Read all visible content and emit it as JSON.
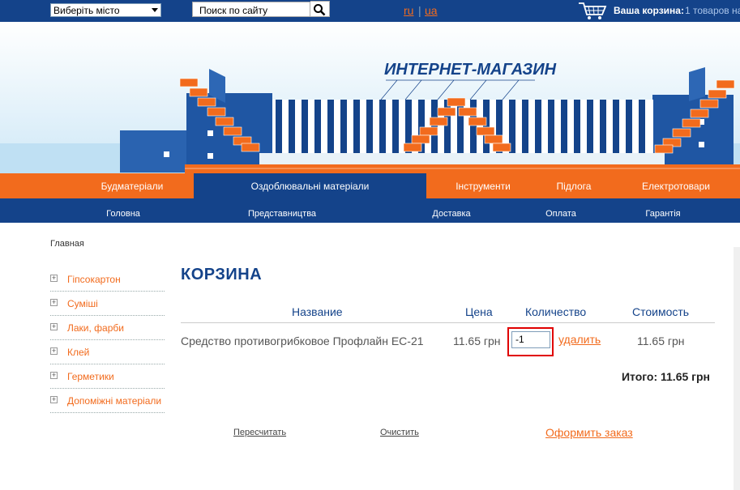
{
  "topbar": {
    "city_select": "Виберіть місто",
    "search_placeholder": "Поиск по сайту",
    "lang_ru": "ru",
    "lang_sep": "|",
    "lang_ua": "ua",
    "cart_label": "Ваша корзина:",
    "cart_count": "1 товаров на"
  },
  "banner": {
    "title": "ИНТЕРНЕТ-МАГАЗИН"
  },
  "nav_main": [
    {
      "label": "Будматеріали"
    },
    {
      "label": "Оздоблювальні матеріали"
    },
    {
      "label": "Інструменти"
    },
    {
      "label": "Підлога"
    },
    {
      "label": "Електротовари"
    }
  ],
  "nav_sub": [
    {
      "label": "Головна"
    },
    {
      "label": "Представництва"
    },
    {
      "label": "Доставка"
    },
    {
      "label": "Оплата"
    },
    {
      "label": "Гарантія"
    }
  ],
  "breadcrumb": "Главная",
  "sidebar": [
    {
      "label": "Гіпсокартон"
    },
    {
      "label": "Суміші"
    },
    {
      "label": "Лаки, фарби"
    },
    {
      "label": "Клей"
    },
    {
      "label": "Герметики"
    },
    {
      "label": "Допоміжні матеріали"
    }
  ],
  "main": {
    "title": "КОРЗИНА",
    "headers": {
      "name": "Название",
      "price": "Цена",
      "qty": "Количество",
      "cost": "Стоимость"
    },
    "row": {
      "name": "Средство противогрибковое Профлайн ЕС-21",
      "price": "11.65 грн",
      "qty": "-1",
      "delete": "удалить",
      "cost": "11.65 грн"
    },
    "total": "Итого: 11.65 грн",
    "recalc": "Пересчитать",
    "clear": "Очистить",
    "checkout": "Оформить заказ"
  },
  "colors": {
    "brand_blue": "#14438a",
    "accent_orange": "#f26b1d",
    "highlight_red": "#e00000"
  }
}
